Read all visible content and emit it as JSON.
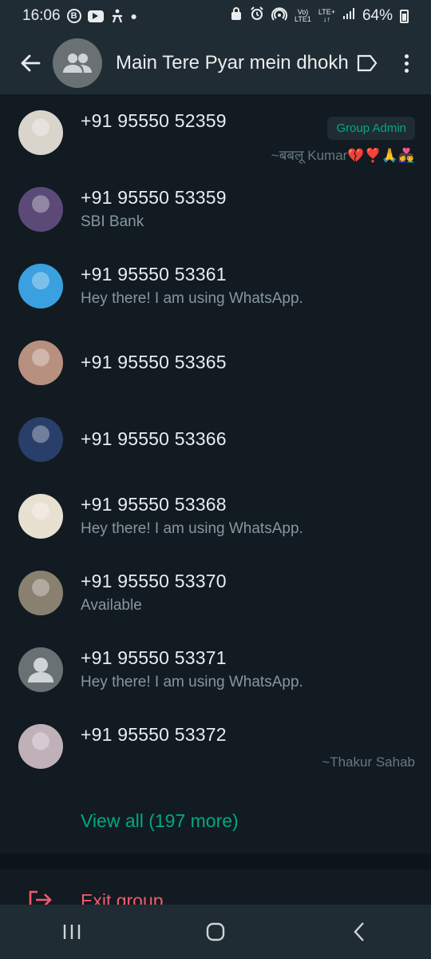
{
  "status_bar": {
    "time": "16:06",
    "left_icons": [
      "b-icon",
      "youtube-icon",
      "fitness-icon",
      "dot-icon"
    ],
    "network_top": "Vo)",
    "network_bottom": "LTE1",
    "lte_top": "LTE+",
    "lte_bottom": "↓↑",
    "battery": "64%"
  },
  "header": {
    "title": "Main Tere Pyar mein dhokh",
    "bg_color": "#202c33"
  },
  "members": [
    {
      "phone": "+91 95550 52359",
      "about": "",
      "badge": "Group Admin",
      "pushname": "~बबलू Kumar💔❣️🙏👩‍❤️‍👨",
      "avatar_color": "#d9d4cc"
    },
    {
      "phone": "+91 95550 53359",
      "about": "SBI Bank",
      "badge": "",
      "pushname": "",
      "avatar_color": "#5b4a78"
    },
    {
      "phone": "+91 95550 53361",
      "about": "Hey there! I am using WhatsApp.",
      "badge": "",
      "pushname": "",
      "avatar_color": "#3aa0e0"
    },
    {
      "phone": "+91 95550 53365",
      "about": "",
      "badge": "",
      "pushname": "",
      "avatar_color": "#b89080"
    },
    {
      "phone": "+91 95550 53366",
      "about": "",
      "badge": "",
      "pushname": "",
      "avatar_color": "#2a3e6a"
    },
    {
      "phone": "+91 95550 53368",
      "about": "Hey there! I am using WhatsApp.",
      "badge": "",
      "pushname": "",
      "avatar_color": "#e8e0d0"
    },
    {
      "phone": "+91 95550 53370",
      "about": "Available",
      "badge": "",
      "pushname": "",
      "avatar_color": "#8a8070"
    },
    {
      "phone": "+91 95550 53371",
      "about": "Hey there! I am using WhatsApp.",
      "badge": "",
      "pushname": "",
      "avatar_color": "#6a7175"
    },
    {
      "phone": "+91 95550 53372",
      "about": "",
      "badge": "",
      "pushname": "~Thakur Sahab",
      "avatar_color": "#c0b0b8"
    }
  ],
  "view_all": "View all (197 more)",
  "exit_group": "Exit group",
  "colors": {
    "accent": "#00a884",
    "danger": "#f15c6d",
    "background": "#111b21",
    "secondary_text": "#8696a0"
  }
}
